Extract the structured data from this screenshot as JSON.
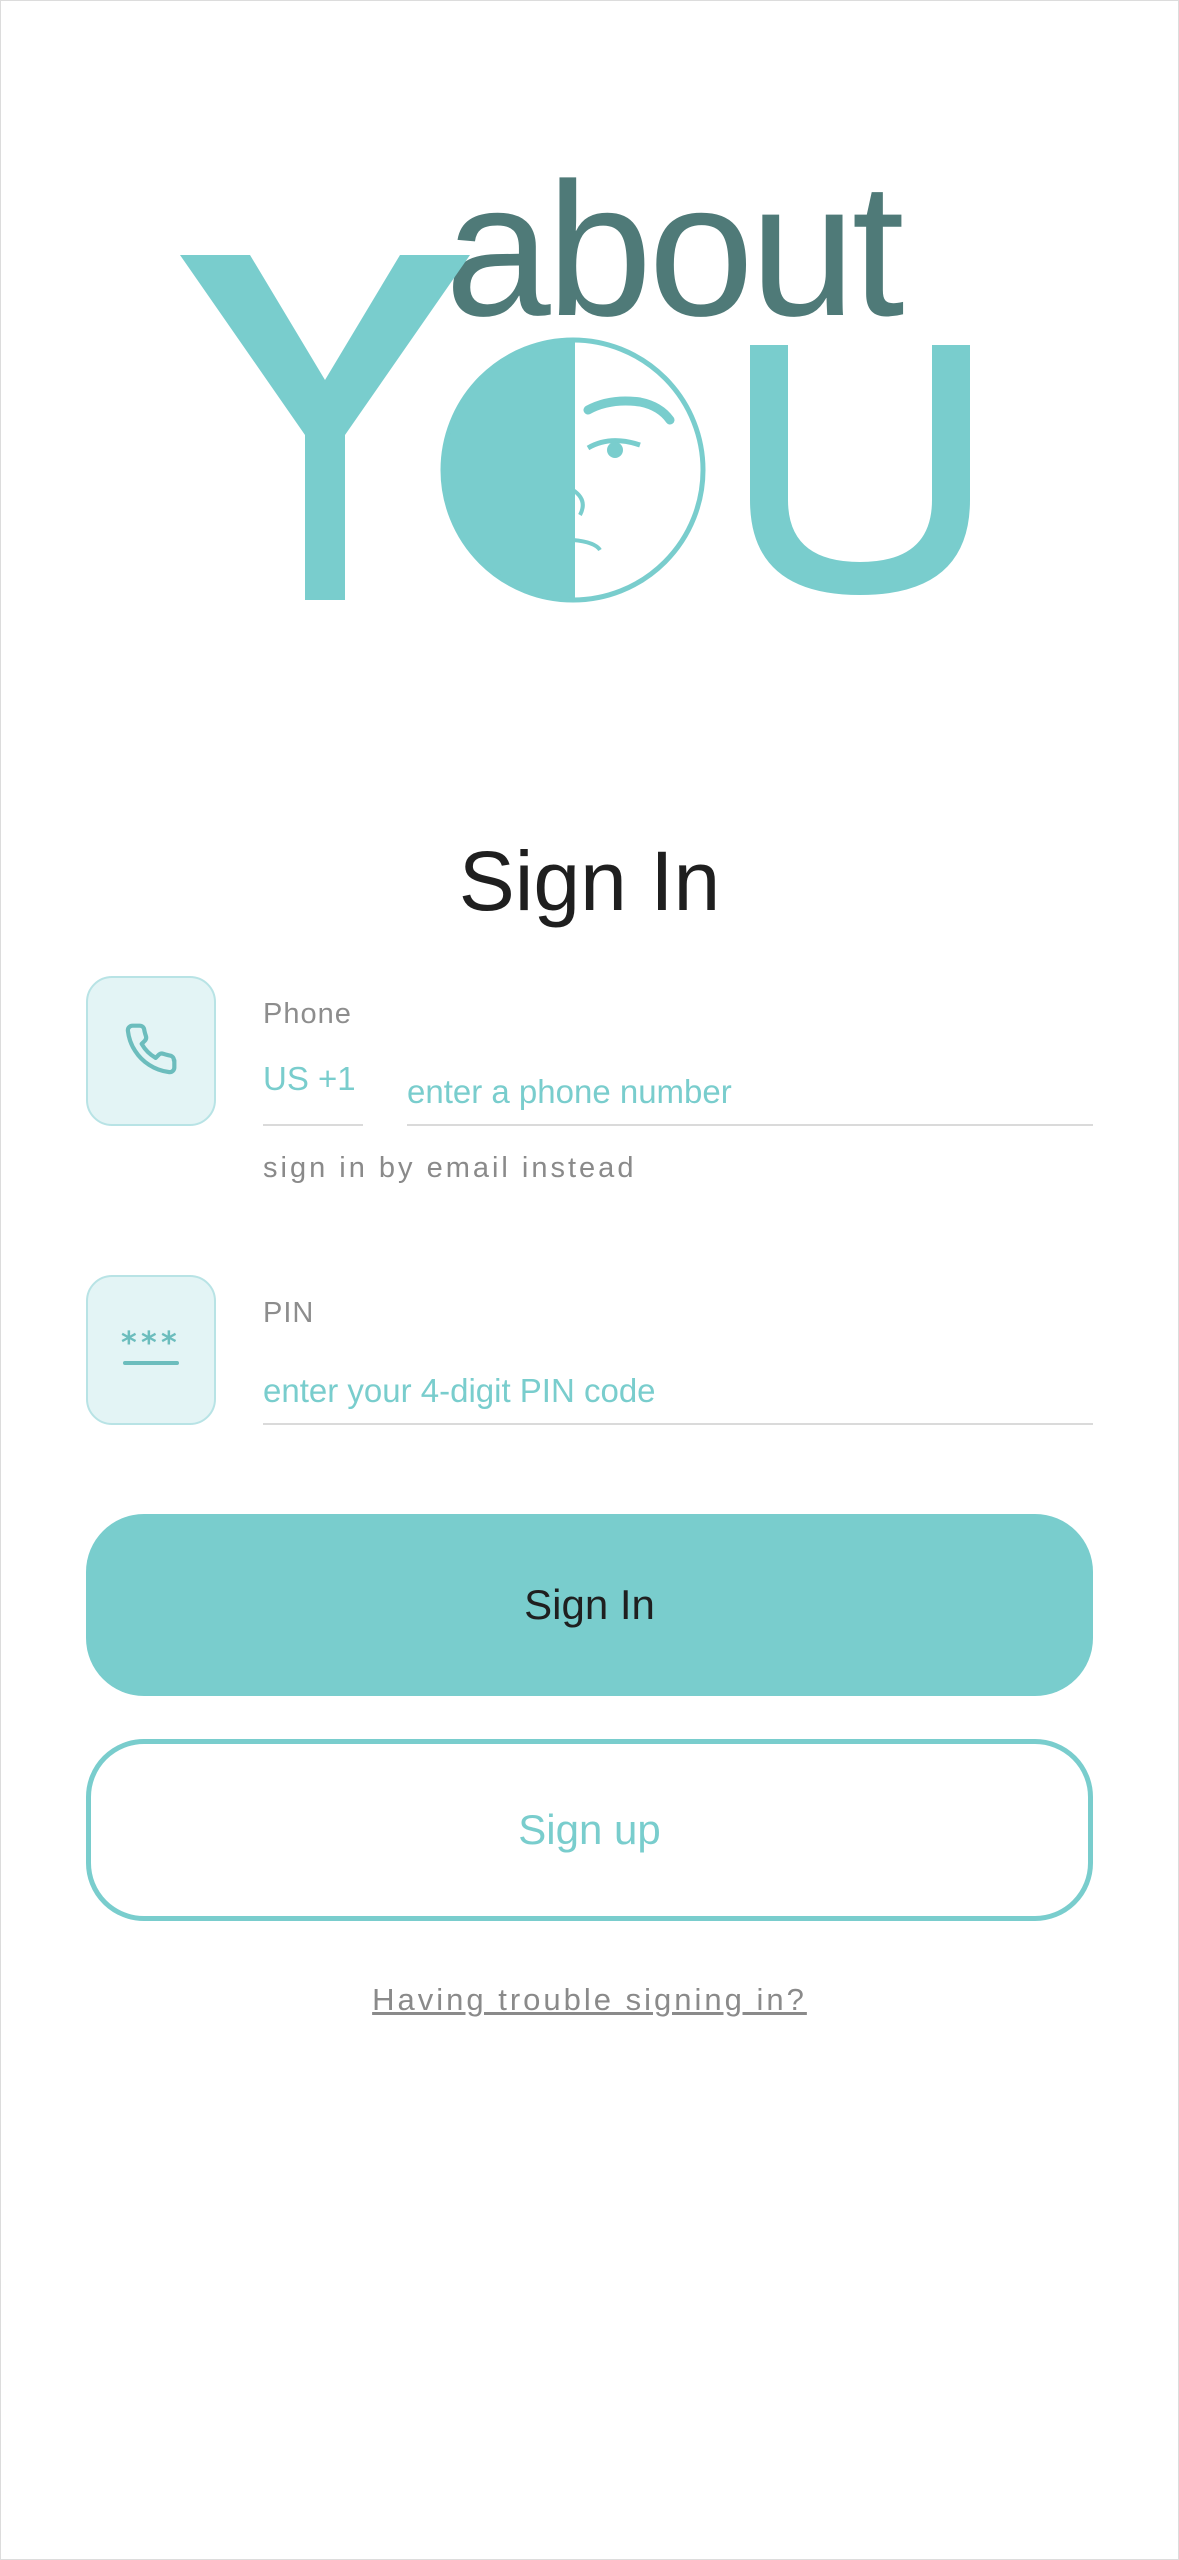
{
  "app": {
    "logo_text_top": "about",
    "logo_text_bottom": "YOU",
    "colors": {
      "teal": "#79cdcd",
      "dark_teal": "#4f7a78",
      "text": "#1f1f1f",
      "muted": "#8a8a8a"
    }
  },
  "page": {
    "title": "Sign In"
  },
  "phone_field": {
    "icon": "phone-icon",
    "label": "Phone",
    "country_code": "US +1",
    "value": "",
    "placeholder": "enter a phone number",
    "alt_link": "sign in by email instead"
  },
  "pin_field": {
    "icon": "pin-code-icon",
    "label": "PIN",
    "value": "",
    "placeholder": "enter your 4-digit PIN code"
  },
  "actions": {
    "sign_in": "Sign In",
    "sign_up": "Sign up",
    "trouble": "Having trouble signing in?"
  }
}
